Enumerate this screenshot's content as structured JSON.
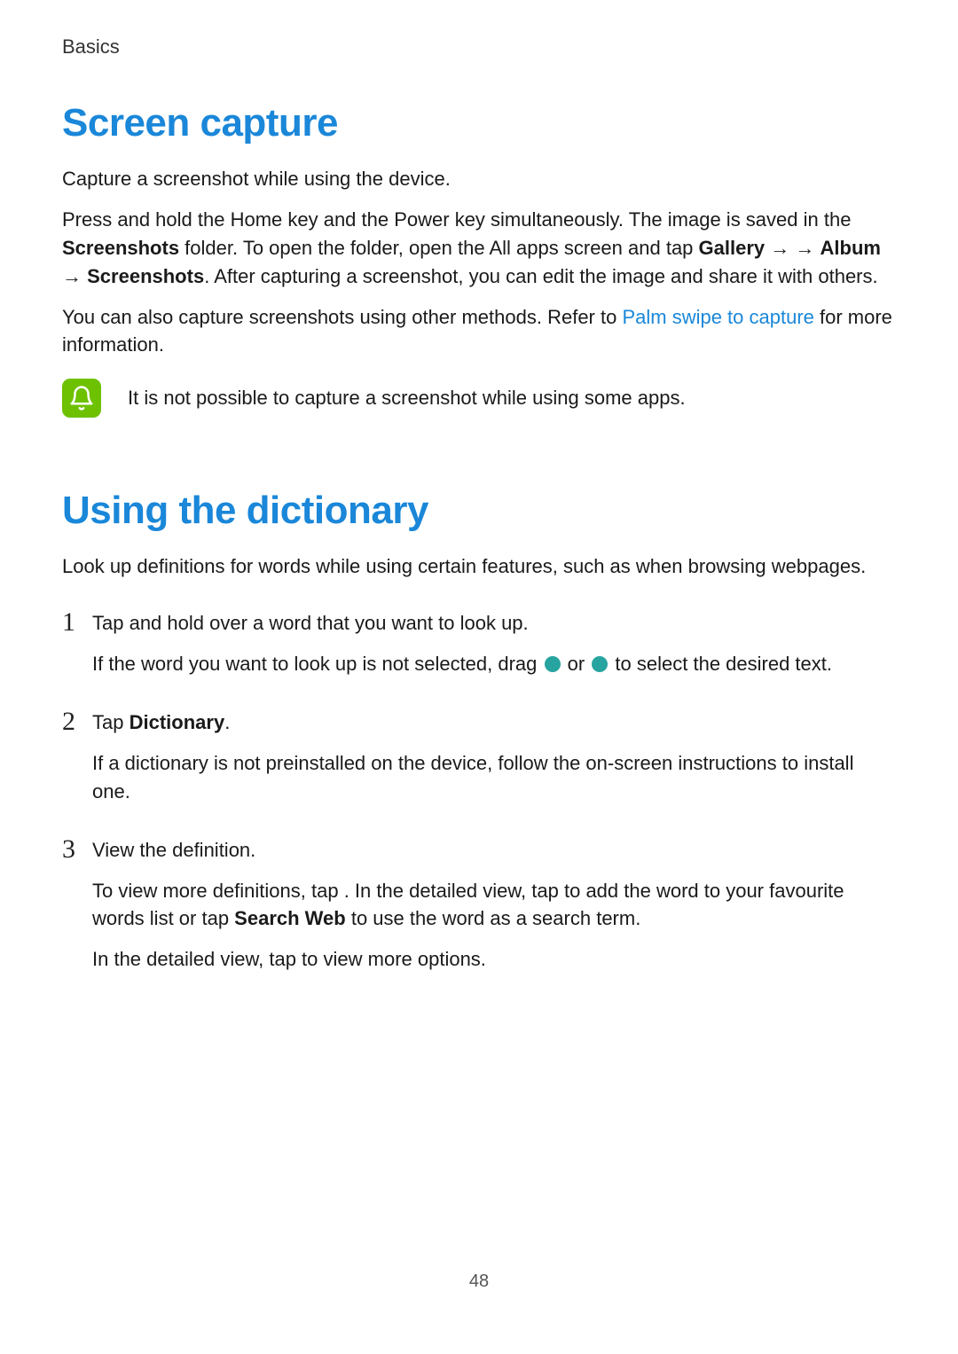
{
  "chapter": "Basics",
  "section1": {
    "title": "Screen capture",
    "intro": "Capture a screenshot while using the device.",
    "p2": {
      "t1": "Press and hold the Home key and the Power key simultaneously. The image is saved in the ",
      "b1": "Screenshots",
      "t2": " folder. To open the folder, open the All apps screen and tap ",
      "b2": "Gallery",
      "arrow1": " → ",
      "b3": "",
      "arrow2": " → ",
      "b4": "Album",
      "arrow3": " → ",
      "b5": "Screenshots",
      "t3": ". After capturing a screenshot, you can edit the image and share it with others."
    },
    "p3": {
      "t1": "You can also capture screenshots using other methods. Refer to ",
      "link": "Palm swipe to capture",
      "t2": " for more information."
    },
    "note": "It is not possible to capture a screenshot while using some apps."
  },
  "section2": {
    "title": "Using the dictionary",
    "intro": "Look up definitions for words while using certain features, such as when browsing webpages.",
    "step1": {
      "num": "1",
      "l1": "Tap and hold over a word that you want to look up.",
      "l2a": "If the word you want to look up is not selected, drag ",
      "l2b": " or ",
      "l2c": " to select the desired text."
    },
    "step2": {
      "num": "2",
      "l1a": "Tap ",
      "l1b": "Dictionary",
      "l1c": ".",
      "l2": "If a dictionary is not preinstalled on the device, follow the on-screen instructions to install one."
    },
    "step3": {
      "num": "3",
      "l1": "View the definition.",
      "l2a": "To view more definitions, tap ",
      "l2b": ". In the detailed view, tap ",
      "l2c": " to add the word to your favourite words list or tap ",
      "l2d": "Search Web",
      "l2e": " to use the word as a search term.",
      "l3": "In the detailed view, tap  to view more options."
    }
  },
  "page_number": "48"
}
